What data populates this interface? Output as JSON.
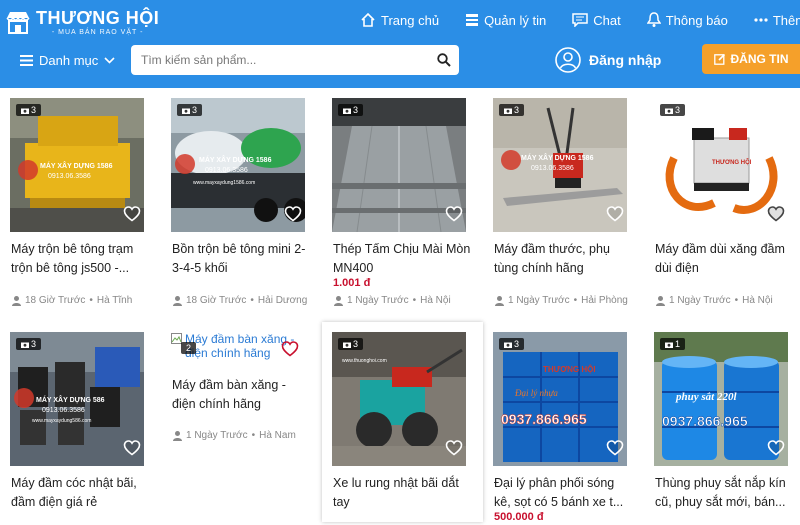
{
  "header": {
    "logo_name": "THƯƠNG HỘI",
    "logo_tagline": "- MUA BÁN RAO VẶT -",
    "nav": [
      {
        "label": "Trang chủ",
        "icon": "home-icon"
      },
      {
        "label": "Quản lý tin",
        "icon": "list-icon"
      },
      {
        "label": "Chat",
        "icon": "chat-icon"
      },
      {
        "label": "Thông báo",
        "icon": "bell-icon"
      },
      {
        "label": "Thêm",
        "icon": "more-icon"
      }
    ],
    "category_label": "Danh mục",
    "search_placeholder": "Tìm kiếm sản phẩm...",
    "login_label": "Đăng nhập",
    "post_label": "ĐĂNG TIN",
    "brand_color": "#2b8ee6",
    "accent_color": "#f5a02a"
  },
  "products": [
    {
      "title": "Máy trộn bê tông trạm trộn bê tông js500 -...",
      "price": "",
      "time": "18 Giờ Trước",
      "location": "Hà Tĩnh",
      "image_count": "3",
      "image": "mixer-yellow",
      "image_text": [
        "MÁY XÂY DỰNG 1586",
        "0913.06.3586"
      ]
    },
    {
      "title": "Bồn trộn bê tông mini 2-3-4-5 khối",
      "price": "",
      "time": "18 Giờ Trước",
      "location": "Hải Dương",
      "image_count": "3",
      "image": "tanks-truck",
      "image_text": [
        "MÁY XÂY DỰNG 1586",
        "0913.06.3586",
        "www.mayxaydung1586.com"
      ]
    },
    {
      "title": "Thép Tấm Chịu Mài Mòn MN400",
      "price": "1.001 đ",
      "time": "1 Ngày Trước",
      "location": "Hà Nội",
      "image_count": "3",
      "image": "steel-sheets",
      "image_text": []
    },
    {
      "title": "Máy đầm thước, phụ tùng chính hãng",
      "price": "",
      "time": "1 Ngày Trước",
      "location": "Hải Phòng",
      "image_count": "3",
      "image": "screed-machine",
      "image_text": [
        "MÁY XÂY DỰNG 1586",
        "0913.06.3586"
      ]
    },
    {
      "title": "Máy đầm dùi xăng đầm dùi điện",
      "price": "",
      "time": "1 Ngày Trước",
      "location": "Hà Nội",
      "image_count": "3",
      "image": "vibrator-orange",
      "image_text": [
        "THƯƠNG HỘI"
      ]
    },
    {
      "title": "Máy đầm cóc nhật bãi, đầm điện giá rẻ",
      "price": "",
      "time": "",
      "location": "",
      "image_count": "3",
      "image": "tamper-machines",
      "image_text": [
        "MÁY XÂY DỰNG 586",
        "0913.06.3586",
        "www.mayxaydung586.com"
      ]
    },
    {
      "title": "Máy đầm bàn xăng - điện chính hãng",
      "price": "",
      "time": "1 Ngày Trước",
      "location": "Hà Nam",
      "image_count": "",
      "image": "broken",
      "image_text": [],
      "image_alt": "Máy đầm bàn xăng - điện chính hãng"
    },
    {
      "title": "Xe lu rung nhật bãi dắt tay",
      "price": "",
      "time": "",
      "location": "",
      "image_count": "3",
      "image": "roller",
      "image_text": [
        "www.thuonghoi.com"
      ]
    },
    {
      "title": "Đại lý phân phối sóng kê, sọt có 5 bánh xe t...",
      "price": "500.000 đ",
      "time": "",
      "location": "",
      "image_count": "3",
      "image": "blue-crates",
      "image_text": [
        "THƯƠNG HỘI",
        "Đại lý nhựa",
        "0937.866.965"
      ]
    },
    {
      "title": "Thùng phuy sắt nắp kín cũ, phuy sắt mới, bán...",
      "price": "",
      "time": "",
      "location": "",
      "image_count": "1",
      "image": "blue-drums",
      "image_text": [
        "phuy sắt 220l",
        "0937.866.965"
      ]
    }
  ],
  "broken_badge": "2"
}
